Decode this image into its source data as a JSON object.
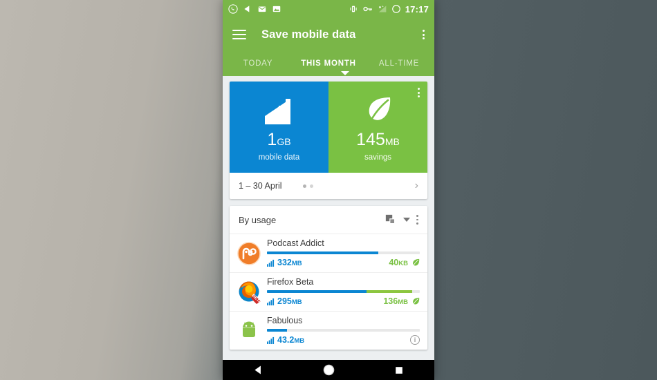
{
  "status_bar": {
    "icons_left": [
      "whatsapp-icon",
      "play-triangle-icon",
      "mail-icon",
      "photo-icon"
    ],
    "icons_right": [
      "vibrate-icon",
      "vpn-key-icon",
      "signal-hplus-icon",
      "alarm-circle-icon"
    ],
    "time": "17:17",
    "background": "#7ab648"
  },
  "app_bar": {
    "menu_icon": "hamburger-icon",
    "title": "Save mobile data",
    "overflow_icon": "overflow-menu-icon"
  },
  "tabs": [
    {
      "label": "TODAY",
      "active": false
    },
    {
      "label": "THIS MONTH",
      "active": true
    },
    {
      "label": "ALL-TIME",
      "active": false
    }
  ],
  "summary_card": {
    "mobile_data": {
      "icon": "signal-bars-icon",
      "value": "1",
      "unit": "GB",
      "label": "mobile data",
      "color": "#0b86d2"
    },
    "savings": {
      "icon": "leaf-icon",
      "value": "145",
      "unit": "MB",
      "label": "savings",
      "color": "#7ac143"
    },
    "overflow_icon": "overflow-menu-icon",
    "date_range": "1 – 30 April",
    "page_dots": 2,
    "active_dot": 0,
    "chevron": "chevron-right-icon"
  },
  "usage_section": {
    "header": "By usage",
    "group_icon": "stacked-squares-icon",
    "caret_icon": "chevron-down-icon",
    "overflow_icon": "overflow-menu-icon",
    "rows": [
      {
        "app_name": "Podcast Addict",
        "icon": "podcast-addict-icon",
        "usage_value": "332",
        "usage_unit": "MB",
        "usage_pct": 73,
        "savings_pct": 0,
        "savings_value": "40",
        "savings_unit": "KB",
        "savings_icon": "leaf-icon",
        "has_info": false
      },
      {
        "app_name": "Firefox Beta",
        "icon": "firefox-beta-icon",
        "usage_value": "295",
        "usage_unit": "MB",
        "usage_pct": 65,
        "savings_pct": 30,
        "savings_value": "136",
        "savings_unit": "MB",
        "savings_icon": "leaf-icon",
        "has_info": false
      },
      {
        "app_name": "Fabulous",
        "icon": "android-robot-icon",
        "usage_value": "43.2",
        "usage_unit": "MB",
        "usage_pct": 13,
        "savings_pct": 0,
        "savings_value": "",
        "savings_unit": "",
        "savings_icon": "",
        "has_info": true,
        "info_icon": "info-icon"
      }
    ]
  },
  "nav_bar": {
    "back": "back-triangle-icon",
    "home": "home-circle-icon",
    "recents": "recents-square-icon"
  }
}
